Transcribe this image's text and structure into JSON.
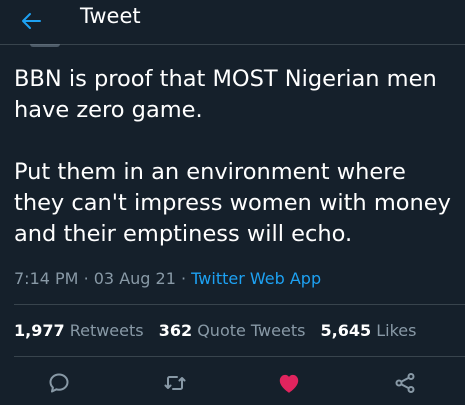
{
  "header": {
    "title": "Tweet",
    "back_icon": "arrow-left-icon"
  },
  "tweet": {
    "text": "BBN is proof that MOST Nigerian men have zero game.\n\nPut them in an environment where they can't impress women with money and their emptiness will echo.",
    "time": "7:14 PM",
    "date": "03 Aug 21",
    "separator": "·",
    "source": "Twitter Web App"
  },
  "stats": {
    "retweets_count": "1,977",
    "retweets_label": "Retweets",
    "quotes_count": "362",
    "quotes_label": "Quote Tweets",
    "likes_count": "5,645",
    "likes_label": "Likes"
  },
  "actions": {
    "reply_icon": "reply-icon",
    "retweet_icon": "retweet-icon",
    "like_icon": "heart-icon",
    "share_icon": "share-icon"
  },
  "colors": {
    "background": "#15202b",
    "accent": "#1da1f2",
    "muted": "#8899a6",
    "like": "#e0245e",
    "divider": "#38444d"
  }
}
